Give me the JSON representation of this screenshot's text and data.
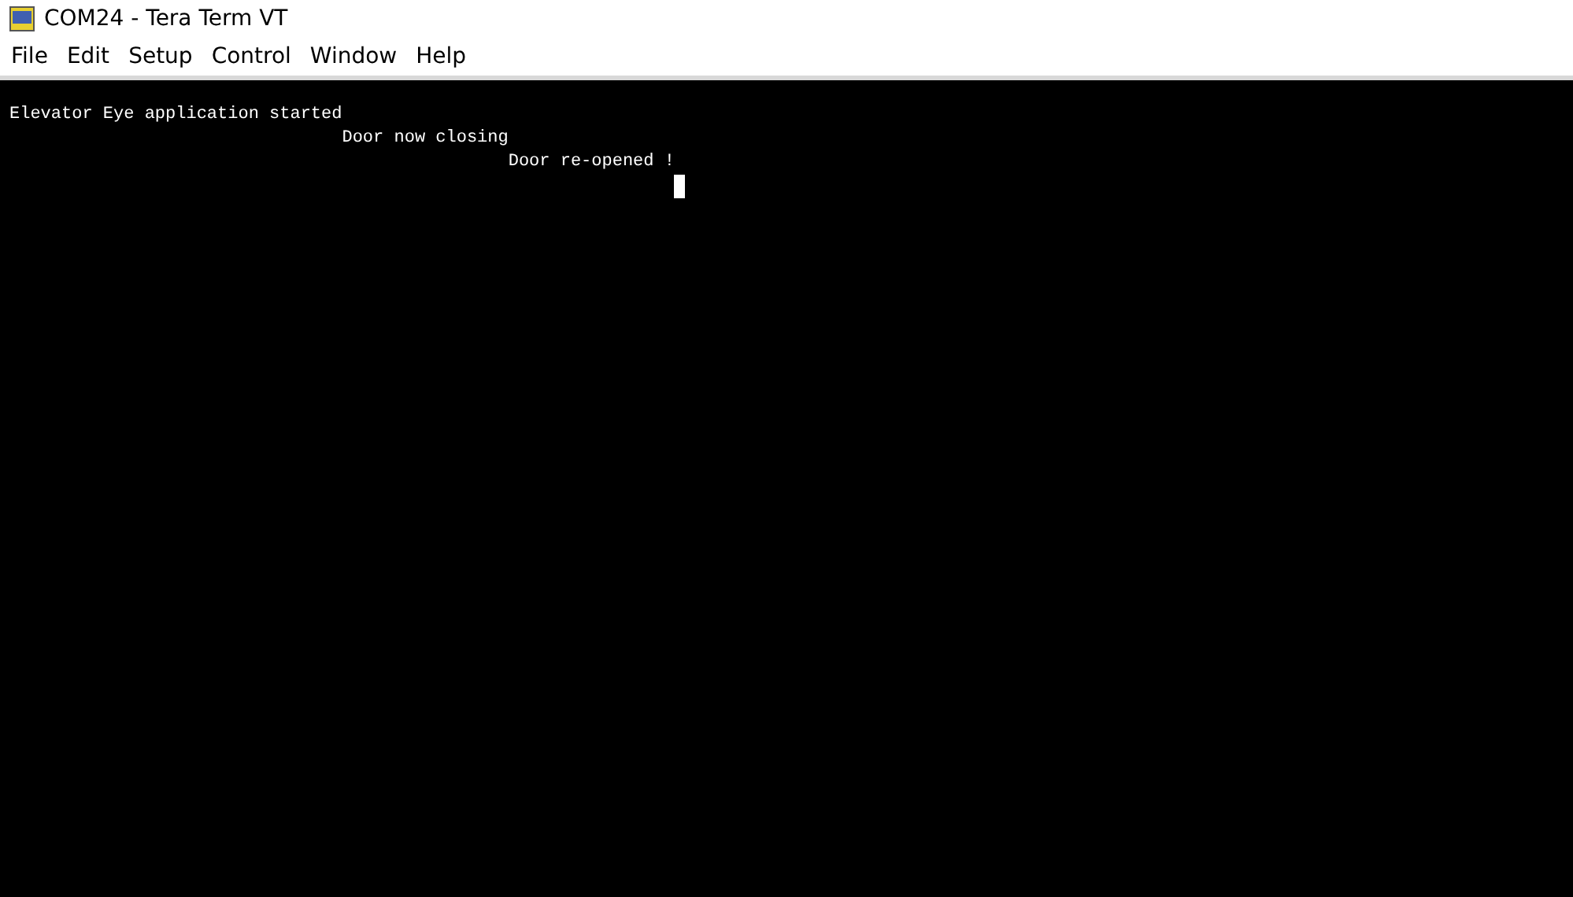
{
  "window": {
    "title": "COM24 - Tera Term VT"
  },
  "menu": [
    "File",
    "Edit",
    "Setup",
    "Control",
    "Window",
    "Help"
  ],
  "terminal": {
    "lines": [
      "Elevator Eye application started",
      "Door now closing",
      "Door re-opened !"
    ],
    "cursor_visible": true
  }
}
